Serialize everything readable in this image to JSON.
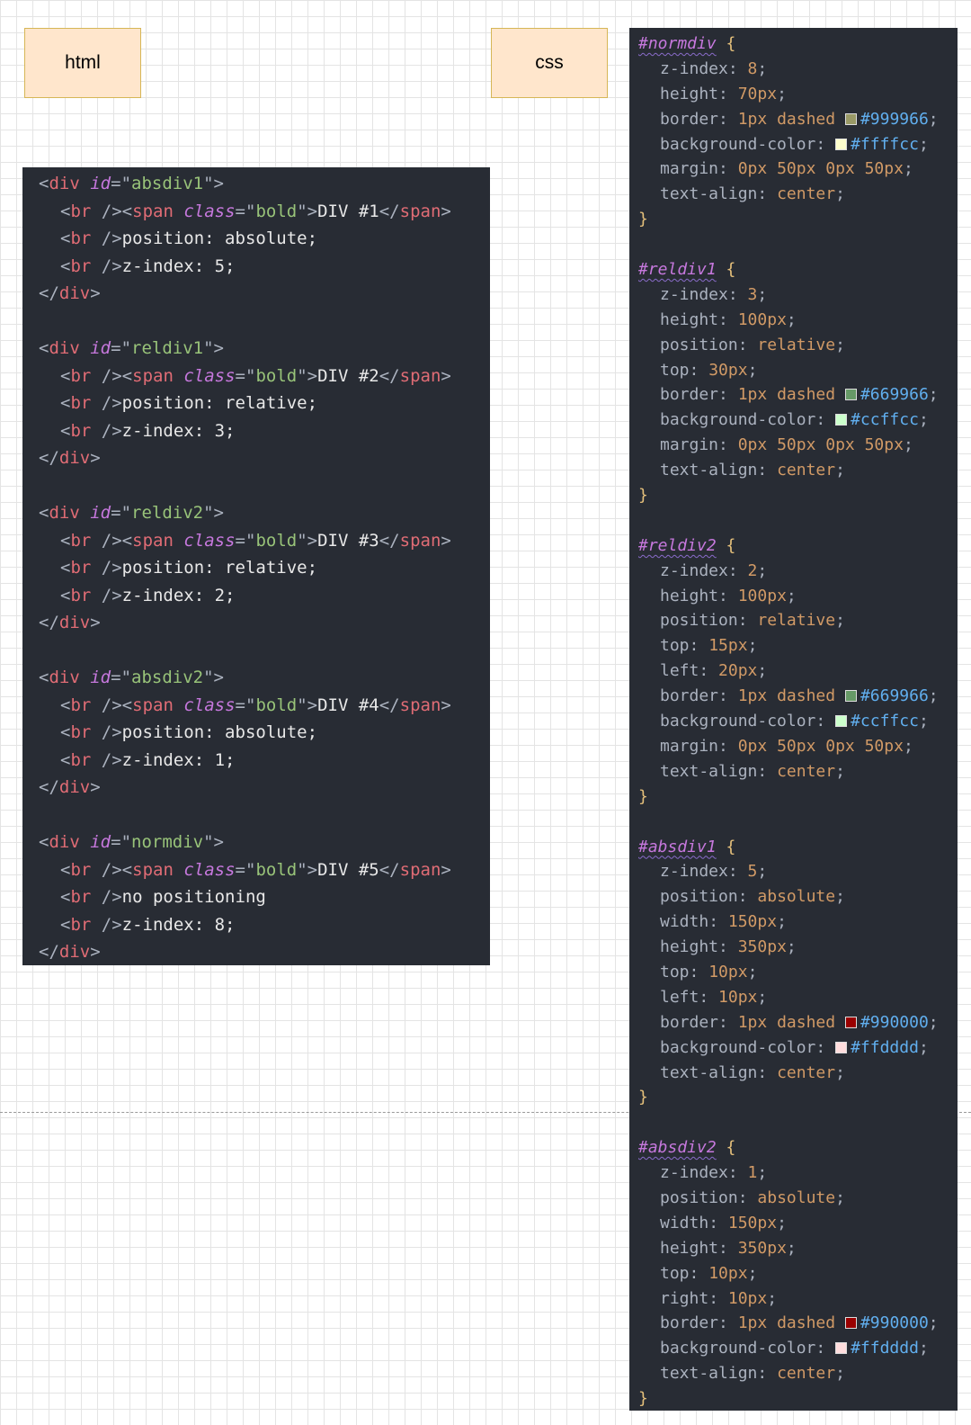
{
  "labels": {
    "html": "html",
    "css": "css"
  },
  "html_code": {
    "blocks": [
      {
        "id": "absdiv1",
        "title": "DIV #1",
        "position": "position: absolute;",
        "zindex": "z-index: 5;"
      },
      {
        "id": "reldiv1",
        "title": "DIV #2",
        "position": "position: relative;",
        "zindex": "z-index: 3;"
      },
      {
        "id": "reldiv2",
        "title": "DIV #3",
        "position": "position: relative;",
        "zindex": "z-index: 2;"
      },
      {
        "id": "absdiv2",
        "title": "DIV #4",
        "position": "position: absolute;",
        "zindex": "z-index: 1;"
      },
      {
        "id": "normdiv",
        "title": "DIV #5",
        "position": "no positioning",
        "zindex": "z-index: 8;"
      }
    ]
  },
  "css_code": {
    "rules": [
      {
        "selector": "#normdiv",
        "decls": [
          {
            "prop": "z-index",
            "val": "8"
          },
          {
            "prop": "height",
            "val": "70px"
          },
          {
            "prop": "border",
            "val": "1px dashed",
            "color": "#999966"
          },
          {
            "prop": "background-color",
            "color": "#ffffcc"
          },
          {
            "prop": "margin",
            "val": "0px 50px 0px 50px"
          },
          {
            "prop": "text-align",
            "val": "center"
          }
        ]
      },
      {
        "selector": "#reldiv1",
        "decls": [
          {
            "prop": "z-index",
            "val": "3"
          },
          {
            "prop": "height",
            "val": "100px"
          },
          {
            "prop": "position",
            "val": "relative"
          },
          {
            "prop": "top",
            "val": "30px"
          },
          {
            "prop": "border",
            "val": "1px dashed",
            "color": "#669966"
          },
          {
            "prop": "background-color",
            "color": "#ccffcc"
          },
          {
            "prop": "margin",
            "val": "0px 50px 0px 50px"
          },
          {
            "prop": "text-align",
            "val": "center"
          }
        ]
      },
      {
        "selector": "#reldiv2",
        "decls": [
          {
            "prop": "z-index",
            "val": "2"
          },
          {
            "prop": "height",
            "val": "100px"
          },
          {
            "prop": "position",
            "val": "relative"
          },
          {
            "prop": "top",
            "val": "15px"
          },
          {
            "prop": "left",
            "val": "20px"
          },
          {
            "prop": "border",
            "val": "1px dashed",
            "color": "#669966"
          },
          {
            "prop": "background-color",
            "color": "#ccffcc"
          },
          {
            "prop": "margin",
            "val": "0px 50px 0px 50px"
          },
          {
            "prop": "text-align",
            "val": "center"
          }
        ]
      },
      {
        "selector": "#absdiv1",
        "decls": [
          {
            "prop": "z-index",
            "val": "5"
          },
          {
            "prop": "position",
            "val": "absolute"
          },
          {
            "prop": "width",
            "val": "150px"
          },
          {
            "prop": "height",
            "val": "350px"
          },
          {
            "prop": "top",
            "val": "10px"
          },
          {
            "prop": "left",
            "val": "10px"
          },
          {
            "prop": "border",
            "val": "1px dashed",
            "color": "#990000"
          },
          {
            "prop": "background-color",
            "color": "#ffdddd"
          },
          {
            "prop": "text-align",
            "val": "center"
          }
        ]
      },
      {
        "selector": "#absdiv2",
        "decls": [
          {
            "prop": "z-index",
            "val": "1"
          },
          {
            "prop": "position",
            "val": "absolute"
          },
          {
            "prop": "width",
            "val": "150px"
          },
          {
            "prop": "height",
            "val": "350px"
          },
          {
            "prop": "top",
            "val": "10px"
          },
          {
            "prop": "right",
            "val": "10px"
          },
          {
            "prop": "border",
            "val": "1px dashed",
            "color": "#990000"
          },
          {
            "prop": "background-color",
            "color": "#ffdddd"
          },
          {
            "prop": "text-align",
            "val": "center"
          }
        ]
      }
    ]
  }
}
